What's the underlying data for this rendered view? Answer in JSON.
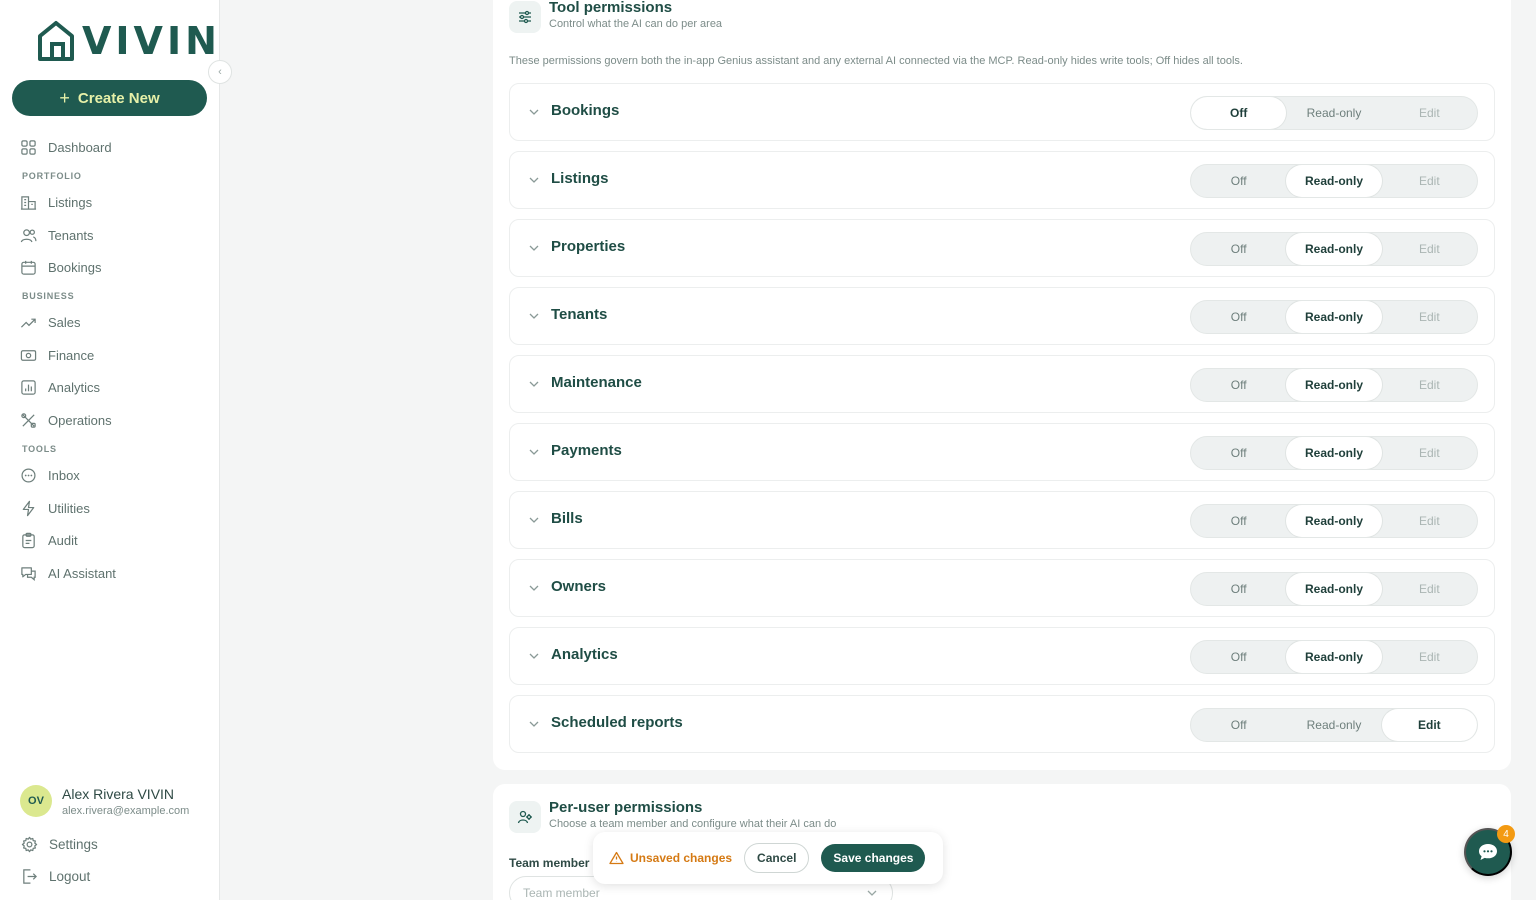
{
  "brand": {
    "name": "VIVIN",
    "accent": "#1f5a50",
    "highlight": "#e6f0a8"
  },
  "sidebar": {
    "create_label": "Create New",
    "dashboard": "Dashboard",
    "sections": {
      "portfolio": "PORTFOLIO",
      "business": "BUSINESS",
      "tools": "TOOLS"
    },
    "portfolio_items": [
      "Listings",
      "Tenants",
      "Bookings"
    ],
    "business_items": [
      "Sales",
      "Finance",
      "Analytics",
      "Operations"
    ],
    "tools_items": [
      "Inbox",
      "Utilities",
      "Audit",
      "AI Assistant"
    ],
    "user": {
      "initials": "OV",
      "name": "Alex Rivera VIVIN",
      "email": "alex.rivera@example.com"
    },
    "settings": "Settings",
    "logout": "Logout"
  },
  "tool_permissions": {
    "title": "Tool permissions",
    "subtitle": "Control what the AI can do per area",
    "description": "These permissions govern both the in-app Genius assistant and any external AI connected via the MCP. Read-only hides write tools; Off hides all tools.",
    "options": [
      "Off",
      "Read-only",
      "Edit"
    ],
    "rows": [
      {
        "label": "Bookings",
        "selected": "Off"
      },
      {
        "label": "Listings",
        "selected": "Read-only"
      },
      {
        "label": "Properties",
        "selected": "Read-only"
      },
      {
        "label": "Tenants",
        "selected": "Read-only"
      },
      {
        "label": "Maintenance",
        "selected": "Read-only"
      },
      {
        "label": "Payments",
        "selected": "Read-only"
      },
      {
        "label": "Bills",
        "selected": "Read-only"
      },
      {
        "label": "Owners",
        "selected": "Read-only"
      },
      {
        "label": "Analytics",
        "selected": "Read-only"
      },
      {
        "label": "Scheduled reports",
        "selected": "Edit"
      }
    ]
  },
  "per_user": {
    "title": "Per-user permissions",
    "subtitle": "Choose a team member and configure what their AI can do",
    "team_label": "Team member",
    "team_placeholder": "Team member"
  },
  "unsaved": {
    "text": "Unsaved changes",
    "cancel": "Cancel",
    "save": "Save changes"
  },
  "chat": {
    "badge": "4"
  }
}
